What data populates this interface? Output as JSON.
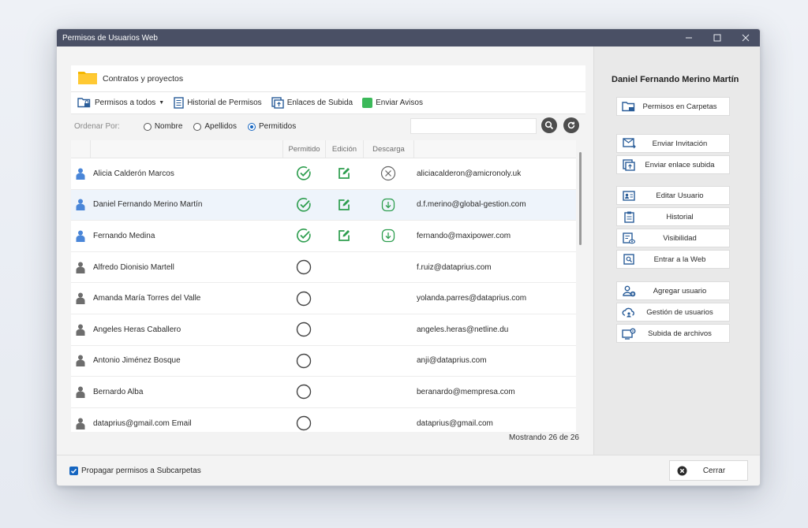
{
  "window": {
    "title": "Permisos de Usuarios Web"
  },
  "folder": {
    "name": "Contratos y proyectos",
    "icon": "folder-icon"
  },
  "toolbar": {
    "permisos_todos": "Permisos a todos",
    "historial": "Historial de Permisos",
    "enlaces": "Enlaces de Subida",
    "avisos": "Enviar Avisos"
  },
  "sort": {
    "label": "Ordenar Por:",
    "options": [
      "Nombre",
      "Apellidos",
      "Permitidos"
    ],
    "selected": "Permitidos"
  },
  "table": {
    "headers": [
      "Permitido",
      "Edición",
      "Descarga"
    ],
    "rows": [
      {
        "name": "Alicia Calderón Marcos",
        "email": "aliciacalderon@amicronoly.uk",
        "permitido": true,
        "edicion": true,
        "descarga": "denied",
        "active": true
      },
      {
        "name": "Daniel Fernando Merino Martín",
        "email": "d.f.merino@global-gestion.com",
        "permitido": true,
        "edicion": true,
        "descarga": "allowed",
        "active": true
      },
      {
        "name": "Fernando Medina",
        "email": "fernando@maxipower.com",
        "permitido": true,
        "edicion": true,
        "descarga": "allowed",
        "active": true
      },
      {
        "name": "Alfredo Dionisio Martell",
        "email": "f.ruiz@dataprius.com",
        "permitido": false,
        "edicion": false,
        "descarga": "none",
        "active": false
      },
      {
        "name": "Amanda María Torres del Valle",
        "email": "yolanda.parres@dataprius.com",
        "permitido": false,
        "edicion": false,
        "descarga": "none",
        "active": false
      },
      {
        "name": "Angeles Heras Caballero",
        "email": "angeles.heras@netline.du",
        "permitido": false,
        "edicion": false,
        "descarga": "none",
        "active": false
      },
      {
        "name": "Antonio Jiménez Bosque",
        "email": "anji@dataprius.com",
        "permitido": false,
        "edicion": false,
        "descarga": "none",
        "active": false
      },
      {
        "name": "Bernardo Alba",
        "email": "beranardo@mempresa.com",
        "permitido": false,
        "edicion": false,
        "descarga": "none",
        "active": false
      },
      {
        "name": "dataprius@gmail.com Email",
        "email": "dataprius@gmail.com",
        "permitido": false,
        "edicion": false,
        "descarga": "none",
        "active": false
      }
    ],
    "showing": "Mostrando 26 de 26"
  },
  "right": {
    "selected_user": "Daniel Fernando Merino Martín",
    "buttons": [
      "Permisos en Carpetas",
      "Enviar Invitación",
      "Enviar enlace subida",
      "Editar Usuario",
      "Historial",
      "Visibilidad",
      "Entrar a la Web",
      "Agregar usuario",
      "Gestión de usuarios",
      "Subida de archivos"
    ]
  },
  "footer": {
    "propagar": "Propagar permisos a Subcarpetas",
    "propagar_checked": true,
    "cerrar": "Cerrar"
  },
  "colors": {
    "green": "#2e9e4f",
    "blue_user": "#4a86d8",
    "gray_user": "#6d6d6d",
    "titlebar": "#4a5065",
    "accent": "#1565c0"
  }
}
